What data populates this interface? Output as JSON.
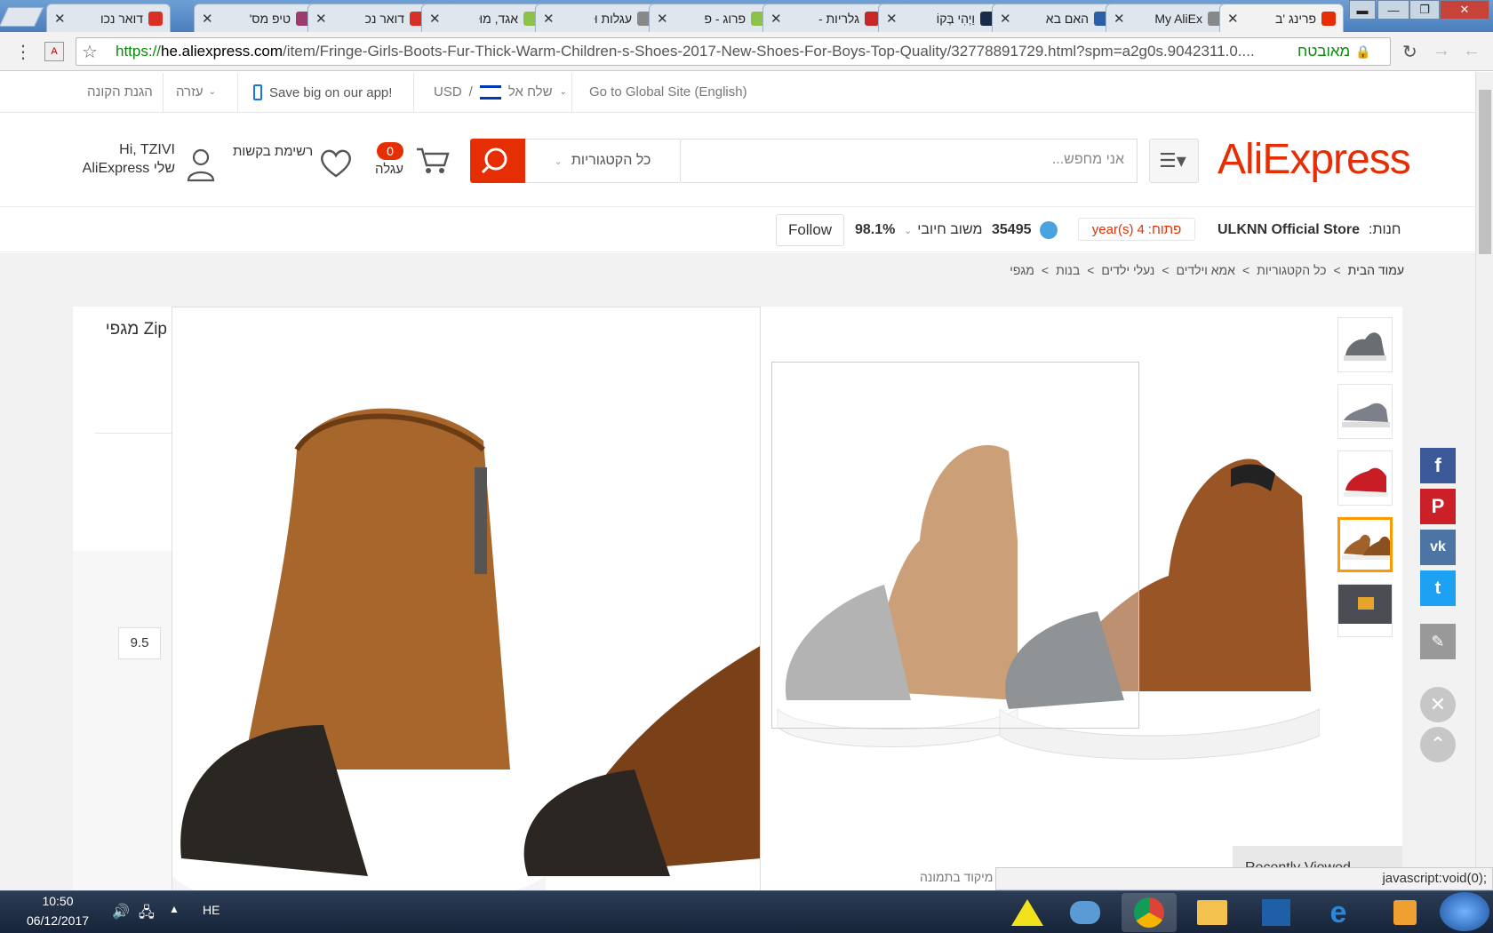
{
  "browser": {
    "tabs": [
      {
        "title": "פרינג 'ב",
        "active": true,
        "favicon_color": "#e62e04"
      },
      {
        "title": "My AliEx",
        "active": false,
        "favicon_color": "#888888"
      },
      {
        "title": "האם בא",
        "active": false,
        "favicon_color": "#2a5fa8"
      },
      {
        "title": "וַיְהִי בְּקוֹ",
        "active": false,
        "favicon_color": "#1a2a4a"
      },
      {
        "title": "גלריות -",
        "active": false,
        "favicon_color": "#c62828"
      },
      {
        "title": "פרוג - פ",
        "active": false,
        "favicon_color": "#8bc34a"
      },
      {
        "title": "עגלות וּ",
        "active": false,
        "favicon_color": "#888888"
      },
      {
        "title": "אגד, מוּ",
        "active": false,
        "favicon_color": "#8bc34a"
      },
      {
        "title": "דואר נכ",
        "active": false,
        "favicon_color": "#d93025"
      },
      {
        "title": "טיפ מס'",
        "active": false,
        "favicon_color": "#9c3b6e"
      },
      {
        "title": "דואר נכו",
        "active": false,
        "favicon_color": "#d93025"
      }
    ],
    "url_proto": "https://",
    "url_host": "he.aliexpress.com",
    "url_path": "/item/Fringe-Girls-Boots-Fur-Thick-Warm-Children-s-Shoes-2017-New-Shoes-For-Boys-Top-Quality/32778891729.html?spm=a2g0s.9042311.0....",
    "secure_label": "מאובטח",
    "status_text": "javascript:void(0);"
  },
  "topbar": {
    "buyer_protection": "הגנת הקונה",
    "help": "עזרה",
    "app_promo": "Save big on our app!",
    "currency": "USD",
    "ship_to": "שלח אל",
    "global_site": "Go to Global Site (English)"
  },
  "header": {
    "logo": "AliExpress",
    "search_placeholder": "אני מחפש...",
    "category_select": "כל הקטגוריות",
    "cart_count": "0",
    "cart_label": "עגלה",
    "wishlist_label": "רשימת בקשות",
    "greeting": "Hi, TZIVI",
    "my_account": "AliExpress שלי"
  },
  "store": {
    "label": "חנות:",
    "name": "ULKNN Official Store",
    "open_label": "פתוח:",
    "open_years": "4",
    "open_unit": "year(s)",
    "score": "35495",
    "feedback_label": "משוב חיובי",
    "feedback_value": "98.1%",
    "follow": "Follow"
  },
  "breadcrumbs": [
    "עמוד הבית",
    "כל הקטגוריות",
    "אמא וילדים",
    "נעלי ילדים",
    "בנות",
    "מגפי"
  ],
  "product": {
    "title_partial": "Zip מגפי",
    "size_option": "9.5",
    "zoom_hint": "מיקוד בתמונה",
    "recently_viewed": "Recently Viewed"
  },
  "social": [
    "facebook-icon",
    "pinterest-icon",
    "vk-icon",
    "twitter-icon"
  ],
  "taskbar": {
    "time": "10:50",
    "date": "06/12/2017",
    "lang": "HE"
  }
}
